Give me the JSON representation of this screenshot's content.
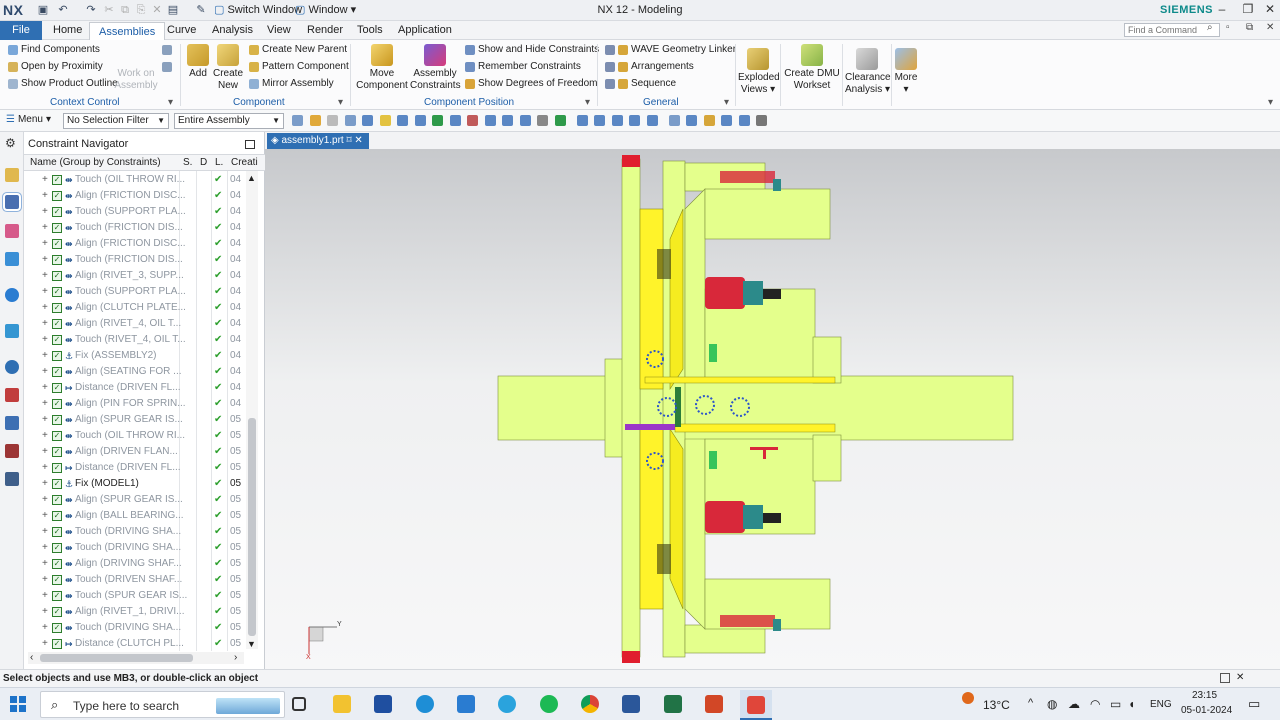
{
  "titlebar": {
    "logo": "NX",
    "switch_window": "Switch Window",
    "window_menu": "Window",
    "title": "NX 12 - Modeling",
    "brand": "SIEMENS"
  },
  "menubar": {
    "tabs": [
      "File",
      "Home",
      "Assemblies",
      "Curve",
      "Analysis",
      "View",
      "Render",
      "Tools",
      "Application"
    ],
    "active": "Assemblies",
    "search_placeholder": "Find a Command"
  },
  "ribbon": {
    "context_control": {
      "items": [
        "Find Components",
        "Open by Proximity",
        "Show Product Outline"
      ],
      "work_on_assembly": "Work on Assembly",
      "label": "Context Control"
    },
    "component": {
      "add": "Add",
      "create_new": "Create New",
      "items": [
        "Create New Parent",
        "Pattern Component",
        "Mirror Assembly"
      ],
      "label": "Component"
    },
    "component_position": {
      "move_component": "Move Component",
      "assembly_constraints": "Assembly Constraints",
      "items": [
        "Show and Hide Constraints",
        "Remember Constraints",
        "Show Degrees of Freedom"
      ],
      "label": "Component Position"
    },
    "general": {
      "items": [
        "WAVE Geometry Linker",
        "Arrangements",
        "Sequence"
      ],
      "label": "General"
    },
    "exploded_views": "Exploded Views",
    "create_dmu_workset": "Create DMU Workset",
    "clearance_analysis": "Clearance Analysis",
    "more": "More"
  },
  "toolbar2": {
    "menu": "Menu",
    "selection_filter": "No Selection Filter",
    "scope": "Entire Assembly"
  },
  "navigator": {
    "title": "Constraint Navigator",
    "columns": [
      "Name (Group by Constraints)",
      "S.",
      "D",
      "L.",
      "Creati"
    ],
    "rows": [
      {
        "icon": "⇹",
        "label": "Touch (OIL THROW RI...",
        "num": "04"
      },
      {
        "icon": "⇹",
        "label": "Align (FRICTION DISC...",
        "num": "04"
      },
      {
        "icon": "⇹",
        "label": "Touch (SUPPORT PLA...",
        "num": "04"
      },
      {
        "icon": "⇹",
        "label": "Touch (FRICTION DIS...",
        "num": "04"
      },
      {
        "icon": "⇹",
        "label": "Align (FRICTION DISC...",
        "num": "04"
      },
      {
        "icon": "⇹",
        "label": "Touch (FRICTION DIS...",
        "num": "04"
      },
      {
        "icon": "⇹",
        "label": "Align (RIVET_3, SUPP...",
        "num": "04"
      },
      {
        "icon": "⇹",
        "label": "Touch (SUPPORT PLA...",
        "num": "04"
      },
      {
        "icon": "⇹",
        "label": "Align (CLUTCH PLATE...",
        "num": "04"
      },
      {
        "icon": "⇹",
        "label": "Align (RIVET_4, OIL T...",
        "num": "04"
      },
      {
        "icon": "⇹",
        "label": "Touch (RIVET_4, OIL T...",
        "num": "04"
      },
      {
        "icon": "⚓",
        "label": "Fix (ASSEMBLY2)",
        "num": "04"
      },
      {
        "icon": "⇹",
        "label": "Align (SEATING FOR ...",
        "num": "04"
      },
      {
        "icon": "↦",
        "label": "Distance (DRIVEN FL...",
        "num": "04"
      },
      {
        "icon": "⇹",
        "label": "Align (PIN FOR SPRIN...",
        "num": "04"
      },
      {
        "icon": "⇹",
        "label": "Align (SPUR GEAR IS...",
        "num": "05"
      },
      {
        "icon": "⇹",
        "label": "Touch (OIL THROW RI...",
        "num": "05"
      },
      {
        "icon": "⇹",
        "label": "Align (DRIVEN FLAN...",
        "num": "05"
      },
      {
        "icon": "↦",
        "label": "Distance (DRIVEN FL...",
        "num": "05"
      },
      {
        "icon": "⚓",
        "label": "Fix (MODEL1)",
        "num": "05",
        "active": true
      },
      {
        "icon": "⇹",
        "label": "Align (SPUR GEAR IS...",
        "num": "05"
      },
      {
        "icon": "⇹",
        "label": "Align (BALL BEARING...",
        "num": "05"
      },
      {
        "icon": "⇹",
        "label": "Touch (DRIVING SHA...",
        "num": "05"
      },
      {
        "icon": "⇹",
        "label": "Touch (DRIVING SHA...",
        "num": "05"
      },
      {
        "icon": "⇹",
        "label": "Align (DRIVING SHAF...",
        "num": "05"
      },
      {
        "icon": "⇹",
        "label": "Touch (DRIVEN SHAF...",
        "num": "05"
      },
      {
        "icon": "⇹",
        "label": "Touch (SPUR GEAR IS...",
        "num": "05"
      },
      {
        "icon": "⇹",
        "label": "Align (RIVET_1, DRIVI...",
        "num": "05"
      },
      {
        "icon": "⇹",
        "label": "Touch (DRIVING SHA...",
        "num": "05"
      },
      {
        "icon": "↦",
        "label": "Distance (CLUTCH PL...",
        "num": "05"
      }
    ]
  },
  "document": {
    "tab": "assembly1.prt",
    "triad_y": "Y",
    "triad_x": "X"
  },
  "status": "Select objects and use MB3, or double-click an object",
  "taskbar": {
    "search": "Type here to search",
    "temperature": "13°C",
    "language": "ENG",
    "time": "23:15",
    "date": "05-01-2024"
  },
  "colors": {
    "accent": "#2f6fb3",
    "brand": "#0d8a8a",
    "model_body": "#e4ff8c",
    "spring": "#d8283a"
  }
}
